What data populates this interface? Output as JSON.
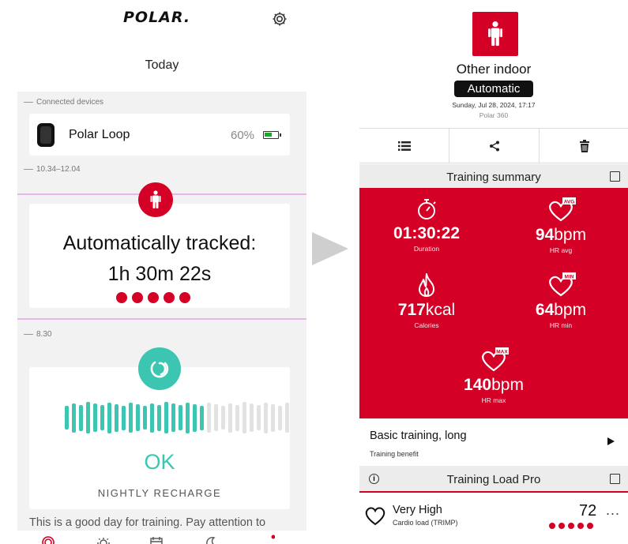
{
  "left_screen": {
    "brand": "POLAR.",
    "title": "Today",
    "section_connected": "Connected devices",
    "device": {
      "name": "Polar Loop",
      "battery": "60%",
      "battery_level": 0.6
    },
    "section_time1": "10.34–12.04",
    "auto_tracked": {
      "line1": "Automatically tracked:",
      "line2": "1h 30m 22s",
      "dots": 5
    },
    "section_time2": "8.30",
    "recharge": {
      "status": "OK",
      "label": "NIGHTLY RECHARGE",
      "bar_filled": 20,
      "bar_total": 32
    },
    "tip": "This is a good day for training. Pay attention to",
    "nav_icons": [
      "activity-rings-icon",
      "sun-icon",
      "calendar-icon",
      "moon-icon",
      "more-icon"
    ]
  },
  "right_screen": {
    "sport": "Other indoor",
    "mode": "Automatic",
    "date": "Sunday, Jul 28, 2024, 17:17",
    "device": "Polar 360",
    "toolbar_icons": [
      "list-icon",
      "share-icon",
      "trash-icon"
    ],
    "summary_title": "Training summary",
    "metrics": [
      {
        "id": "duration",
        "value": "01:30:22",
        "unit": "",
        "label": "Duration",
        "icon": "stopwatch-icon"
      },
      {
        "id": "hr-avg",
        "value": "94",
        "unit": "bpm",
        "label": "HR avg",
        "icon": "heart-avg-icon",
        "tag": "AVG"
      },
      {
        "id": "calories",
        "value": "717",
        "unit": "kcal",
        "label": "Calories",
        "icon": "flame-icon"
      },
      {
        "id": "hr-min",
        "value": "64",
        "unit": "bpm",
        "label": "HR min",
        "icon": "heart-min-icon",
        "tag": "MIN"
      },
      {
        "id": "hr-max",
        "value": "140",
        "unit": "bpm",
        "label": "HR max",
        "icon": "heart-max-icon",
        "tag": "MAX"
      }
    ],
    "benefit_title": "Basic training, long",
    "benefit_sub": "Training benefit",
    "load_title": "Training Load Pro",
    "info_glyph": "i",
    "cardio": {
      "level": "Very High",
      "label": "Cardio load (TRIMP)",
      "value": "72",
      "more": "...",
      "dots": 5
    }
  },
  "colors": {
    "polar_red": "#d40025",
    "recharge_teal": "#3cc6b2",
    "highlight": "#e8b6e8",
    "battery_green": "#1fa62c"
  }
}
